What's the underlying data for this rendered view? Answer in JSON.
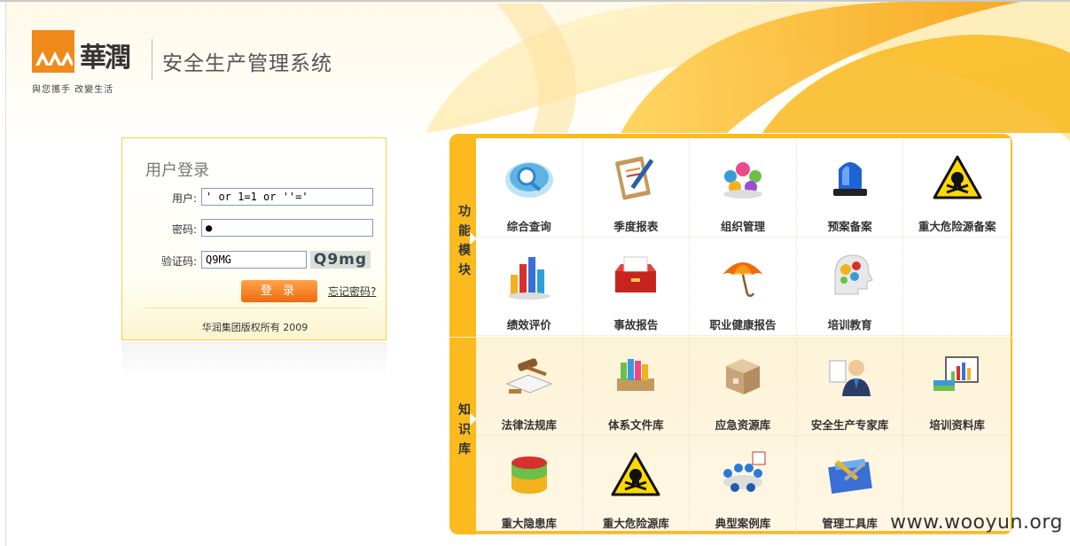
{
  "header": {
    "logo_text": "華潤",
    "logo_slogan": "與您攜手 改變生活",
    "system_title": "安全生产管理系统"
  },
  "login": {
    "title": "用户登录",
    "username_label": "用户:",
    "username_value": "' or 1=1 or ''='",
    "password_label": "密码:",
    "password_value": "●",
    "captcha_label": "验证码:",
    "captcha_value": "Q9MG",
    "captcha_image_text": "Q9mg",
    "login_button": "登 录",
    "forgot_link": "忘记密码?",
    "copyright": "华润集团版权所有 2009"
  },
  "modules": {
    "function_tab": "功能模块",
    "knowledge_tab": "知识库",
    "function_items": [
      {
        "label": "综合查询",
        "icon": "search-query-icon"
      },
      {
        "label": "季度报表",
        "icon": "report-clipboard-icon"
      },
      {
        "label": "组织管理",
        "icon": "organization-people-icon"
      },
      {
        "label": "预案备案",
        "icon": "siren-light-icon"
      },
      {
        "label": "重大危险源备案",
        "icon": "hazard-skull-icon"
      },
      {
        "label": "绩效评价",
        "icon": "performance-chart-icon"
      },
      {
        "label": "事故报告",
        "icon": "incident-folder-icon"
      },
      {
        "label": "职业健康报告",
        "icon": "umbrella-icon"
      },
      {
        "label": "培训教育",
        "icon": "training-head-gears-icon"
      }
    ],
    "knowledge_items": [
      {
        "label": "法律法规库",
        "icon": "law-gavel-book-icon"
      },
      {
        "label": "体系文件库",
        "icon": "documents-books-icon"
      },
      {
        "label": "应急资源库",
        "icon": "emergency-box-icon"
      },
      {
        "label": "安全生产专家库",
        "icon": "expert-person-icon"
      },
      {
        "label": "培训资料库",
        "icon": "training-materials-icon"
      },
      {
        "label": "重大隐患库",
        "icon": "hidden-danger-cylinder-icon"
      },
      {
        "label": "重大危险源库",
        "icon": "hazard-skull-icon"
      },
      {
        "label": "典型案例库",
        "icon": "typical-case-meeting-icon"
      },
      {
        "label": "管理工具库",
        "icon": "management-tools-icon"
      }
    ]
  },
  "watermark": "www.wooyun.org",
  "colors": {
    "accent_orange": "#f08a1a",
    "panel_yellow": "#fbbb1e",
    "login_border": "#f3d24a"
  }
}
